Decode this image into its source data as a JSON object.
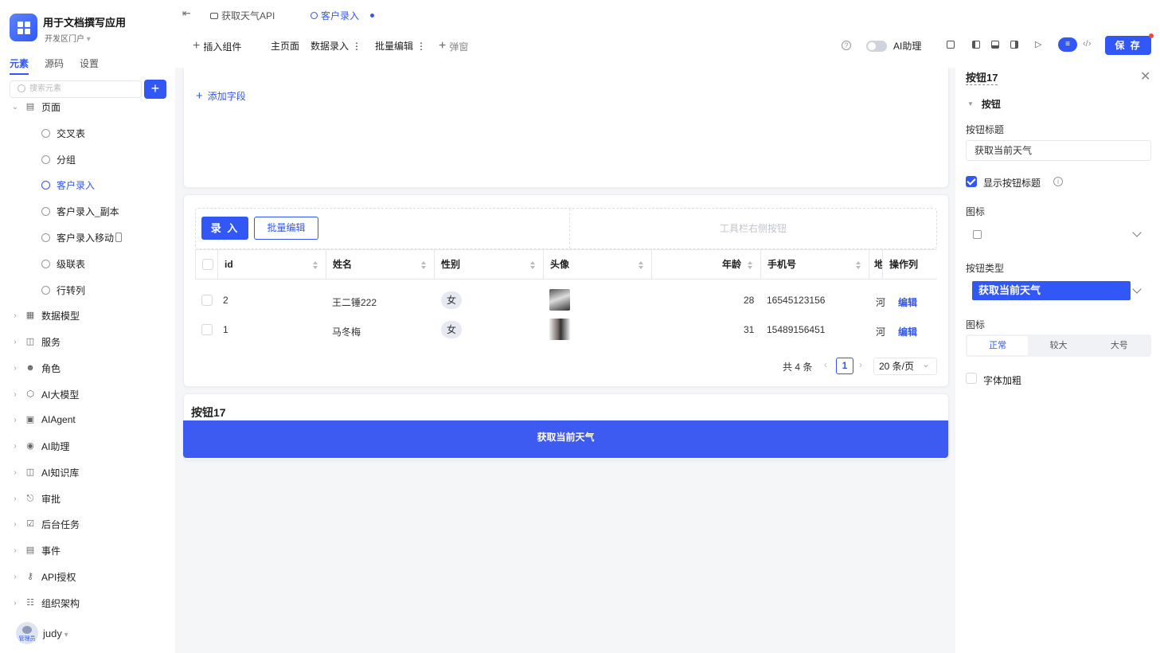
{
  "app": {
    "title": "用于文档撰写应用",
    "portal": "开发区门户"
  },
  "left_tabs": [
    "元素",
    "源码",
    "设置"
  ],
  "search": {
    "placeholder": "搜索元素"
  },
  "add_button": "+",
  "tree": {
    "root": "页面",
    "pages": [
      "交叉表",
      "分组",
      "客户录入",
      "客户录入_副本",
      "客户录入移动",
      "级联表",
      "行转列"
    ],
    "selected_page": "客户录入",
    "groups": [
      "数据模型",
      "服务",
      "角色",
      "AI大模型",
      "AIAgent",
      "AI助理",
      "AI知识库",
      "审批",
      "后台任务",
      "事件",
      "API授权",
      "组织架构"
    ]
  },
  "user": {
    "name": "judy",
    "role": "管理员"
  },
  "tabs": [
    {
      "label": "获取天气API"
    },
    {
      "label": "客户录入",
      "active": true
    }
  ],
  "toolbar": {
    "insert": "插入组件",
    "home": "主页面",
    "data_entry": "数据录入",
    "batch_edit": "批量编辑",
    "popup": "弹窗",
    "ai_assistant": "AI助理",
    "save": "保 存",
    "help": "?"
  },
  "canvas": {
    "add_field": "添加字段",
    "table_toolbar": {
      "entry_button": "录 入",
      "batch_button": "批量编辑",
      "right_placeholder": "工具栏右侧按钮"
    },
    "table": {
      "columns": [
        "id",
        "姓名",
        "性别",
        "头像",
        "年龄",
        "手机号",
        "地",
        "操作列"
      ],
      "rows": [
        {
          "id": "2",
          "name": "王二锤222",
          "gender": "女",
          "age": "28",
          "phone": "16545123156",
          "addr": "河",
          "action": "编辑"
        },
        {
          "id": "1",
          "name": "马冬梅",
          "gender": "女",
          "age": "31",
          "phone": "15489156451",
          "addr": "河",
          "action": "编辑"
        }
      ]
    },
    "pager": {
      "total": "共 4 条",
      "page": "1",
      "size": "20 条/页"
    },
    "button_block": {
      "title": "按钮17",
      "label": "获取当前天气"
    }
  },
  "props": {
    "title": "按钮17",
    "section": "按钮",
    "button_title_label": "按钮标题",
    "button_title_value": "获取当前天气",
    "show_title_label": "显示按钮标题",
    "icon_label": "图标",
    "button_type_label": "按钮类型",
    "button_type_value": "获取当前天气",
    "size_label": "图标",
    "sizes": [
      "正常",
      "较大",
      "大号"
    ],
    "bold_label": "字体加粗"
  },
  "colors": {
    "accent": "#3157f6",
    "danger": "#f5483b"
  }
}
